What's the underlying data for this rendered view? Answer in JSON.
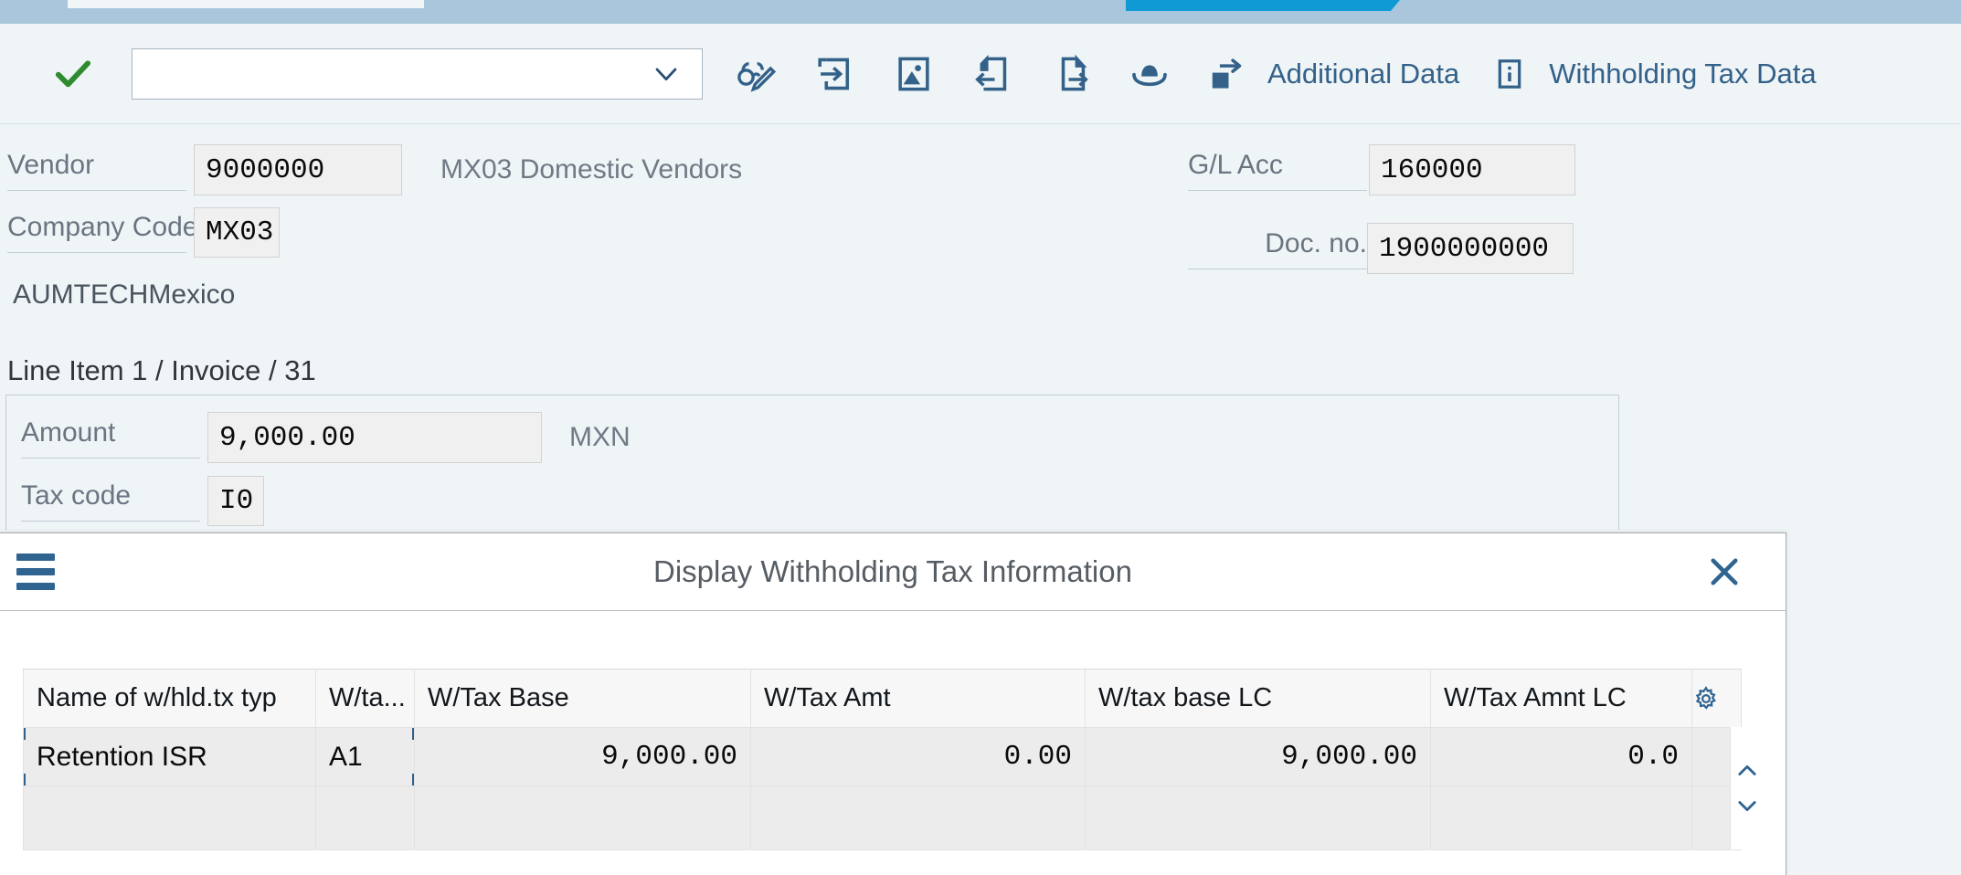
{
  "app": {
    "background_color": "#eff4f7",
    "accent_color": "#336189",
    "confirm_color": "#2e8b2e"
  },
  "toolbar": {
    "confirm_icon": "green-checkmark-icon",
    "command_field_value": "",
    "command_field_placeholder": "",
    "dropdown_icon": "chevron-down-icon",
    "icons": [
      {
        "name": "display-change-icon",
        "label": "Display/Change"
      },
      {
        "name": "document-overview-icon",
        "label": "Document Overview"
      },
      {
        "name": "picture-icon",
        "label": "Attachment"
      },
      {
        "name": "previous-item-icon",
        "label": "Previous Item"
      },
      {
        "name": "next-item-icon",
        "label": "Next Item"
      },
      {
        "name": "hat-icon",
        "label": "Editing Options"
      }
    ],
    "buttons": [
      {
        "icon": "more-arrow-icon",
        "label": "Additional Data"
      },
      {
        "icon": "info-icon",
        "label": "Withholding Tax Data"
      }
    ]
  },
  "form": {
    "vendor": {
      "label": "Vendor",
      "value": "9000000",
      "description": "MX03 Domestic Vendors"
    },
    "company_code": {
      "label": "Company Code",
      "value": "MX03"
    },
    "company_name": "AUMTECHMexico",
    "gl_account": {
      "label": "G/L Acc",
      "value": "160000"
    },
    "doc_no": {
      "label": "Doc. no.",
      "value": "1900000000"
    },
    "line_item_title": "Line Item 1 / Invoice / 31",
    "amount": {
      "label": "Amount",
      "value": "9,000.00",
      "currency": "MXN"
    },
    "tax_code": {
      "label": "Tax code",
      "value": "I0"
    }
  },
  "dialog": {
    "menu_icon": "hamburger-menu-icon",
    "title": "Display Withholding Tax Information",
    "close_icon": "close-icon",
    "settings_icon": "gear-icon",
    "scroll_up_icon": "chevron-up-icon",
    "scroll_down_icon": "chevron-down-icon",
    "table": {
      "columns": [
        "Name of w/hld.tx typ",
        "W/ta...",
        "W/Tax Base",
        "W/Tax Amt",
        "W/tax base LC",
        "W/Tax Amnt LC"
      ],
      "rows": [
        {
          "name": "Retention ISR",
          "code": "A1",
          "base": "9,000.00",
          "amt": "0.00",
          "base_lc": "9,000.00",
          "amt_lc": "0.0"
        },
        {
          "name": "",
          "code": "",
          "base": "",
          "amt": "",
          "base_lc": "",
          "amt_lc": ""
        }
      ]
    }
  }
}
